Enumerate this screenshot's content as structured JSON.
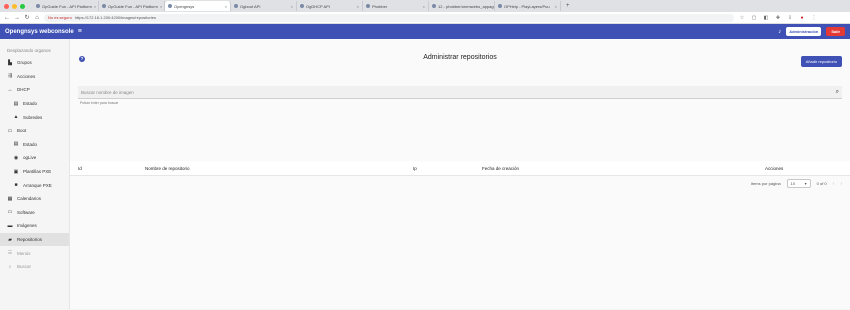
{
  "browser": {
    "tabs": [
      {
        "label": "OpGuide Fun - API Platform"
      },
      {
        "label": "OpGuide Fun - API Platform"
      },
      {
        "label": "Opengnsys",
        "active": true
      },
      {
        "label": "Ogboot API"
      },
      {
        "label": "OgDHCP API"
      },
      {
        "label": "Phobber"
      },
      {
        "label": "12 - phobber/ommwebo_appagent"
      },
      {
        "label": "OPHelp - PlayLayers/Puu"
      }
    ],
    "new_tab": "+",
    "not_secure": "No es seguro",
    "url": "https://172.16.1.200:4200/images/repositories"
  },
  "header": {
    "title": "Opengnsys webconsole",
    "admin_button": "Administración",
    "logout_button": "Salir"
  },
  "sidebar": {
    "search_placeholder": "Desplazando organos",
    "items": [
      {
        "label": "Grupos",
        "icon": "building-icon",
        "glyph": "▙"
      },
      {
        "label": "Acciones",
        "icon": "actions-icon",
        "glyph": "⇶"
      },
      {
        "label": "DHCP",
        "icon": "dhcp-icon",
        "glyph": "↔"
      },
      {
        "label": "Estado",
        "icon": "status-icon",
        "glyph": "▤",
        "sub": true
      },
      {
        "label": "Subredes",
        "icon": "subnet-icon",
        "glyph": "▲",
        "sub": true
      },
      {
        "label": "Boot",
        "icon": "monitor-icon",
        "glyph": "▭"
      },
      {
        "label": "Estado",
        "icon": "status-icon",
        "glyph": "▤",
        "sub": true
      },
      {
        "label": "ogLive",
        "icon": "oglive-icon",
        "glyph": "◉",
        "sub": true
      },
      {
        "label": "Plantillas PXE",
        "icon": "template-icon",
        "glyph": "▣",
        "sub": true
      },
      {
        "label": "Arranque PXE",
        "icon": "boot-icon",
        "glyph": "■",
        "sub": true
      },
      {
        "label": "Calendarios",
        "icon": "calendar-icon",
        "glyph": "▦"
      },
      {
        "label": "Software",
        "icon": "software-icon",
        "glyph": "▭"
      },
      {
        "label": "Imágenes",
        "icon": "image-icon",
        "glyph": "▬"
      },
      {
        "label": "Repositorios",
        "icon": "repository-icon",
        "glyph": "▰",
        "active": true
      },
      {
        "label": "Menús",
        "icon": "menu-icon",
        "glyph": "☰",
        "muted": true
      },
      {
        "label": "Buscar",
        "icon": "search-icon",
        "glyph": "⌕",
        "muted": true
      }
    ]
  },
  "main": {
    "help_glyph": "?",
    "title": "Administrar repositorios",
    "add_button": "Añadir repositorio",
    "search_placeholder": "Buscar nombre de imagen",
    "search_hint": "Pulsar enter para buscar",
    "columns": [
      {
        "label": "Id"
      },
      {
        "label": "Nombre de repositorio"
      },
      {
        "label": "Ip"
      },
      {
        "label": "Fecha de creación"
      },
      {
        "label": "Acciones"
      }
    ],
    "paginator": {
      "label": "Items por página",
      "page_size": "10",
      "range": "0 of 0"
    }
  }
}
